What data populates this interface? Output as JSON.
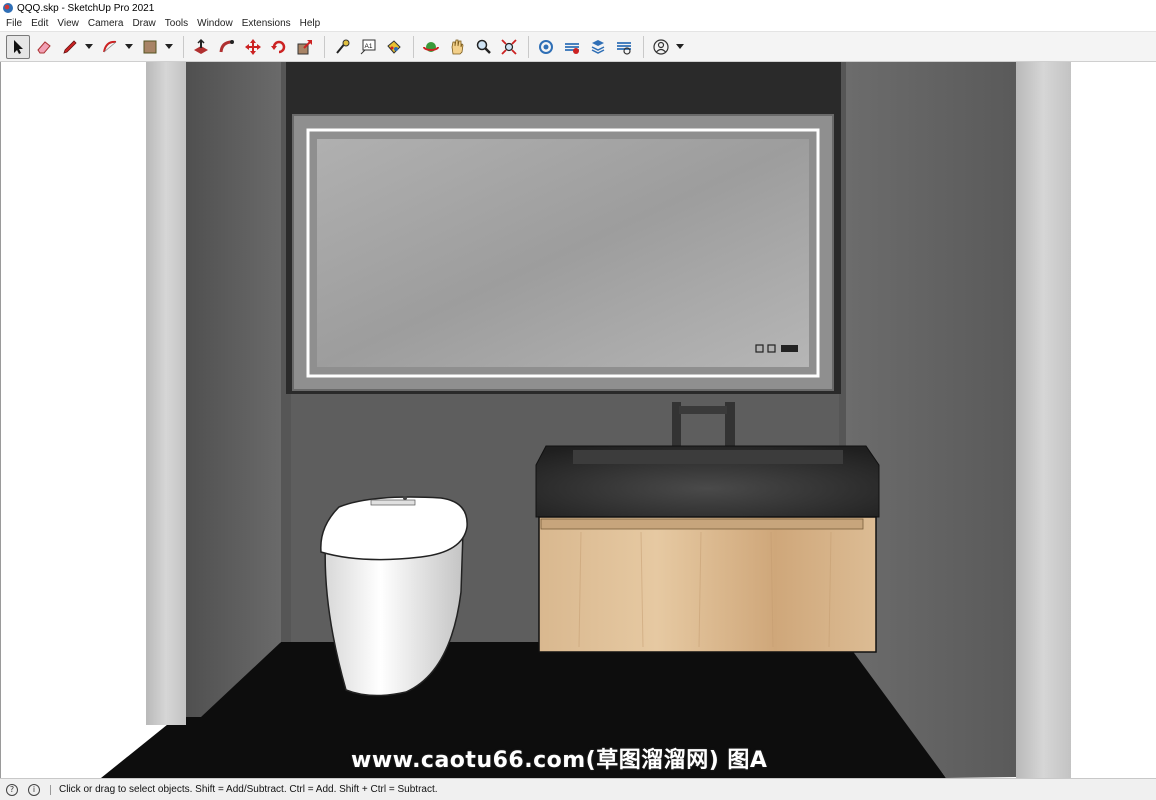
{
  "window": {
    "title": "QQQ.skp - SketchUp Pro 2021"
  },
  "menu": {
    "items": [
      "File",
      "Edit",
      "View",
      "Camera",
      "Draw",
      "Tools",
      "Window",
      "Extensions",
      "Help"
    ]
  },
  "toolbar": {
    "tools": [
      {
        "name": "select-tool",
        "icon": "arrow-cursor-icon",
        "active": true
      },
      {
        "name": "eraser-tool",
        "icon": "eraser-icon"
      },
      {
        "name": "line-tool",
        "icon": "pencil-icon",
        "dropdown": true
      },
      {
        "name": "arc-tool",
        "icon": "arc-icon",
        "dropdown": true
      },
      {
        "name": "rectangle-tool",
        "icon": "rectangle-icon",
        "dropdown": true
      },
      {
        "name": "push-pull-tool",
        "icon": "push-pull-icon"
      },
      {
        "name": "follow-me-tool",
        "icon": "follow-me-icon"
      },
      {
        "name": "move-tool",
        "icon": "move-icon"
      },
      {
        "name": "rotate-tool",
        "icon": "rotate-icon"
      },
      {
        "name": "scale-tool",
        "icon": "scale-icon"
      },
      {
        "name": "tape-measure-tool",
        "icon": "tape-measure-icon"
      },
      {
        "name": "text-tool",
        "icon": "text-icon"
      },
      {
        "name": "paint-bucket-tool",
        "icon": "paint-bucket-icon"
      },
      {
        "name": "orbit-tool",
        "icon": "orbit-icon"
      },
      {
        "name": "pan-tool",
        "icon": "pan-hand-icon"
      },
      {
        "name": "zoom-tool",
        "icon": "zoom-icon"
      },
      {
        "name": "zoom-extents-tool",
        "icon": "zoom-extents-icon"
      },
      {
        "name": "3d-warehouse-button",
        "icon": "warehouse-icon"
      },
      {
        "name": "extension-warehouse-button",
        "icon": "extension-warehouse-icon"
      },
      {
        "name": "layout-button",
        "icon": "layout-icon"
      },
      {
        "name": "extension-manager-button",
        "icon": "extension-manager-icon"
      },
      {
        "name": "account-button",
        "icon": "user-account-icon",
        "dropdown": true
      }
    ],
    "text_tool_label": "A1"
  },
  "colors": {
    "accent_red": "#d02a2a",
    "accent_blue": "#2f6fb6",
    "wall_dark": "#5c5c5c",
    "floor": "#111111",
    "countertop": "#2b2b2b",
    "cabinet_wood": "#d6b48c"
  },
  "watermark": {
    "text": "www.caotu66.com(草图溜溜网) 图A"
  },
  "status": {
    "message": "Click or drag to select objects. Shift = Add/Subtract. Ctrl = Add. Shift + Ctrl = Subtract."
  }
}
